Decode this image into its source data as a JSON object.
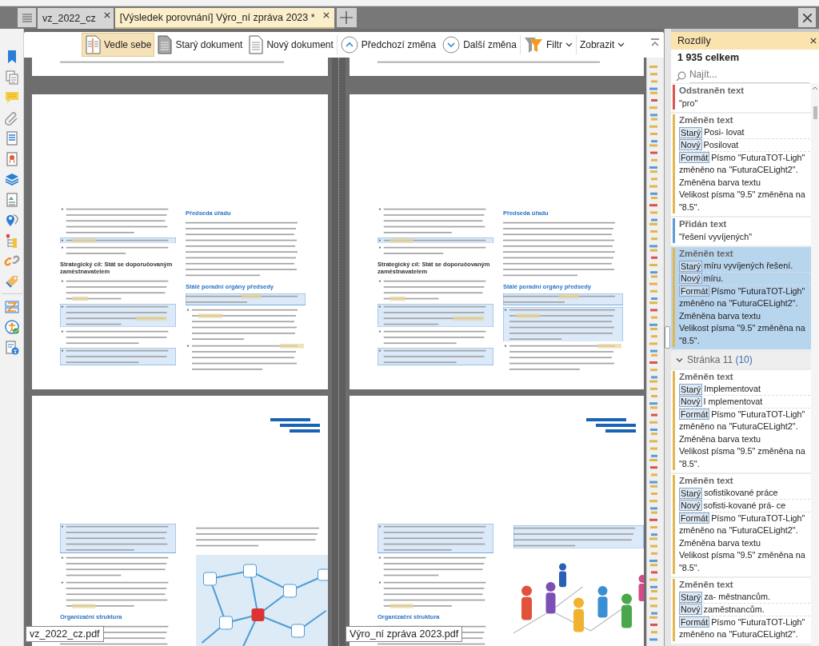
{
  "tabs": [
    {
      "label": "vz_2022_cz",
      "selected": false
    },
    {
      "label": "[Výsledek porovnání] Výro_ní zpráva 2023 *",
      "selected": true
    }
  ],
  "toolbar": [
    {
      "kind": "side_by_side",
      "label": "Vedle sebe",
      "selected": true
    },
    {
      "kind": "old_doc",
      "label": "Starý dokument",
      "selected": false
    },
    {
      "kind": "new_doc",
      "label": "Nový dokument",
      "selected": false
    },
    {
      "kind": "prev",
      "label": "Předchozí změna"
    },
    {
      "kind": "next",
      "label": "Další změna"
    },
    {
      "kind": "filter",
      "label": "Filtr"
    },
    {
      "kind": "menu",
      "label": "Zobrazit"
    }
  ],
  "documents": [
    {
      "file": "vz_2022_cz.pdf",
      "headings": [
        "Strategický cíl: Stát se doporučovaným zaměstnavatelem",
        "Předseda úřadu",
        "Stálé poradní orgány předsedy",
        "Organizační struktura"
      ]
    },
    {
      "file": "Výro_ní zpráva 2023.pdf",
      "headings": [
        "Strategický cíl: Stát se doporučovaným zaměstnavatelem",
        "Předseda úřadu",
        "Stálé poradní orgány předsedy",
        "Organizační struktura"
      ]
    }
  ],
  "panel": {
    "title": "Rozdíly",
    "total": "1 935 celkem",
    "search": {
      "placeholder": "Najít..."
    },
    "items": [
      {
        "kind": "removed",
        "title": "Odstraněn text",
        "color": "#d9534f",
        "selected": false,
        "value": "\"pro\""
      },
      {
        "kind": "changed",
        "title": "Změněn text",
        "color": "#e2b64f",
        "selected": false,
        "old_tag": "Starý",
        "old": "Posi- lovat",
        "new_tag": "Nový",
        "new": "Posilovat",
        "format_tag": "Formát",
        "format": [
          "Písmo \"FuturaTOT-Ligh\"",
          "změněno na \"FuturaCELight2\".",
          "Změněna barva textu",
          "Velikost písma \"9.5\" změněna na",
          "\"8.5\"."
        ]
      },
      {
        "kind": "added",
        "title": "Přidán text",
        "color": "#5b9bd5",
        "selected": false,
        "value": "\"řešení  vyvíjených\""
      },
      {
        "kind": "changed",
        "title": "Změněn text",
        "color": "#e2b64f",
        "selected": true,
        "old_tag": "Starý",
        "old": "míru  vyvíjených řešení.",
        "new_tag": "Nový",
        "new": "míru.",
        "format_tag": "Formát",
        "format": [
          "Písmo \"FuturaTOT-Ligh\"",
          "změněno na \"FuturaCELight2\".",
          "Změněna barva textu",
          "Velikost písma \"9.5\" změněna na",
          "\"8.5\"."
        ]
      },
      {
        "kind": "group",
        "label": "Stránka 11",
        "count": "(10)",
        "expanded": true
      },
      {
        "kind": "changed",
        "title": "Změněn text",
        "color": "#e2b64f",
        "selected": false,
        "old_tag": "Starý",
        "old": "Implementovat",
        "new_tag": "Nový",
        "new": "I mplementovat",
        "format_tag": "Formát",
        "format": [
          "Písmo \"FuturaTOT-Ligh\"",
          "změněno na \"FuturaCELight2\".",
          "Změněna barva textu",
          "Velikost písma \"9.5\" změněna na",
          "\"8.5\"."
        ]
      },
      {
        "kind": "changed",
        "title": "Změněn text",
        "color": "#e2b64f",
        "selected": false,
        "old_tag": "Starý",
        "old": "sofistikované práce",
        "new_tag": "Nový",
        "new": "sofisti-kované prá- ce",
        "format_tag": "Formát",
        "format": [
          "Písmo \"FuturaTOT-Ligh\"",
          "změněno na \"FuturaCELight2\".",
          "Změněna barva textu",
          "Velikost písma \"9.5\" změněna na",
          "\"8.5\"."
        ]
      },
      {
        "kind": "changed",
        "title": "Změněn text",
        "color": "#e2b64f",
        "selected": false,
        "old_tag": "Starý",
        "old": "za- městnancům.",
        "new_tag": "Nový",
        "new": "zaměstnancům.",
        "format_tag": "Formát",
        "format": [
          "Písmo \"FuturaTOT-Ligh\"",
          "změněno na \"FuturaCELight2\"."
        ]
      }
    ]
  }
}
